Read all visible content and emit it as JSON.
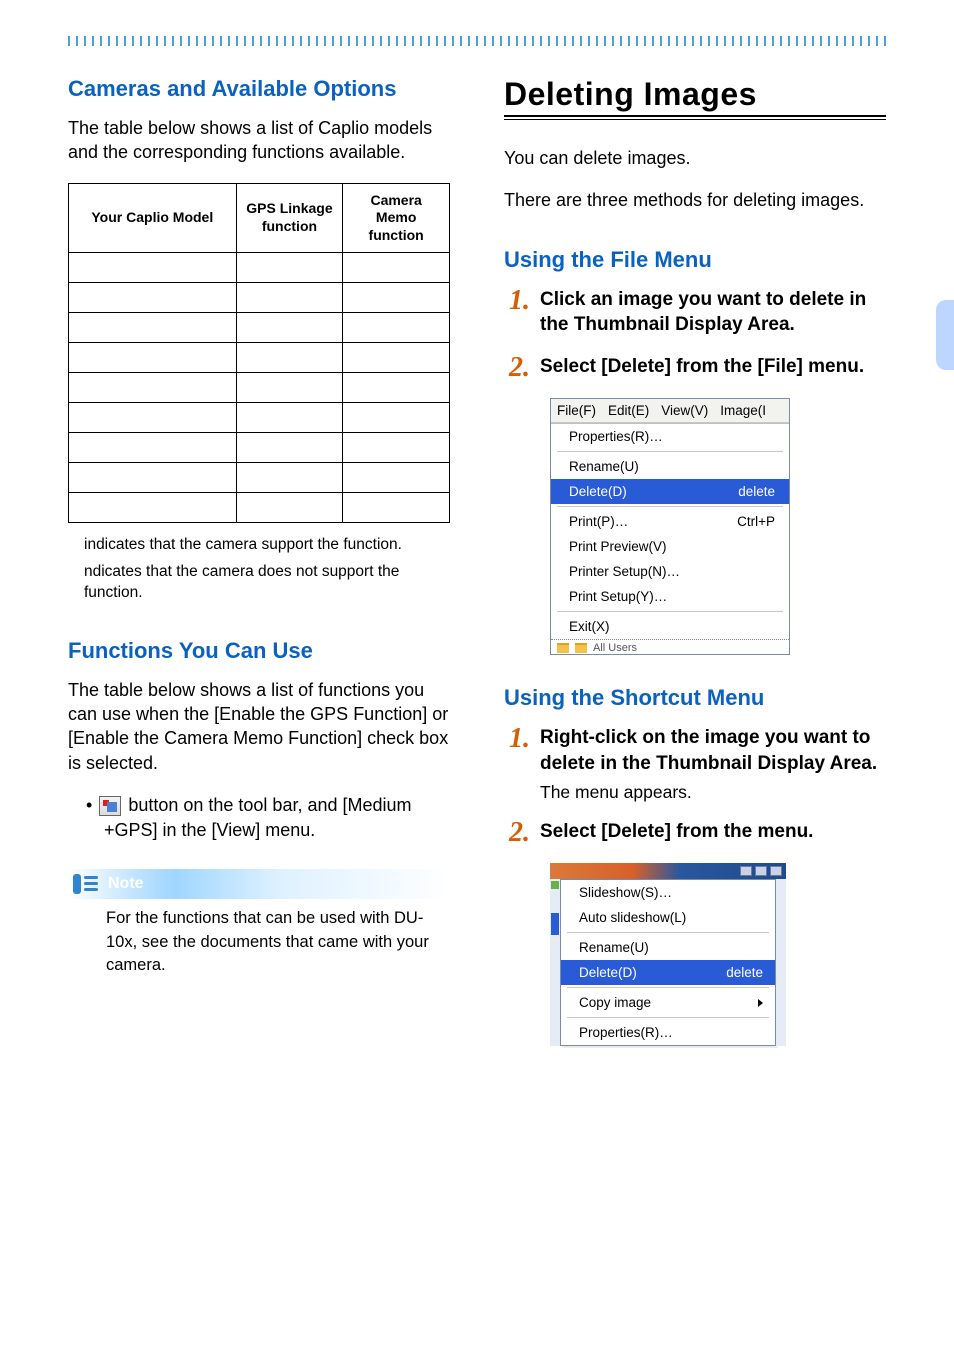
{
  "left": {
    "cameras": {
      "heading": "Cameras and Available Options",
      "intro": "The table below shows a list of Caplio models and the corresponding functions available.",
      "columns": {
        "model": "Your Caplio Model",
        "gps": "GPS Linkage function",
        "memo": "Camera Memo function"
      },
      "row_count": 9,
      "footnote1": "indicates that the camera support the function.",
      "footnote2": "ndicates that the camera does not support the function."
    },
    "functions": {
      "heading": "Functions You Can Use",
      "intro": "The table below shows a list of functions you can use when the [Enable the GPS Function] or [Enable the Camera Memo Function] check box is selected.",
      "bullet1_a": " button on the tool bar, and [Medium +GPS] in the [View] menu.",
      "icon_name": "medium-gps-toolbar-icon"
    },
    "note": {
      "label": "Note",
      "text": "For the functions that can be used with DU-10x, see the documents that came with your camera."
    }
  },
  "right": {
    "title": "Deleting Images",
    "intro1": "You can delete images.",
    "intro2": "There are three methods for deleting images.",
    "filemenu": {
      "heading": "Using the File Menu",
      "step1": "Click an image you want to delete in the Thumbnail Display Area.",
      "step2": "Select [Delete] from the [File] menu.",
      "shot": {
        "menubar": [
          "File(F)",
          "Edit(E)",
          "View(V)",
          "Image(I"
        ],
        "items": [
          {
            "label": "Properties(R)…",
            "accel": ""
          },
          {
            "sep": true
          },
          {
            "label": "Rename(U)",
            "accel": ""
          },
          {
            "label": "Delete(D)",
            "accel": "delete",
            "sel": true
          },
          {
            "sep": true
          },
          {
            "label": "Print(P)…",
            "accel": "Ctrl+P"
          },
          {
            "label": "Print Preview(V)",
            "accel": ""
          },
          {
            "label": "Printer Setup(N)…",
            "accel": ""
          },
          {
            "label": "Print Setup(Y)…",
            "accel": ""
          },
          {
            "sep": true
          },
          {
            "label": "Exit(X)",
            "accel": ""
          }
        ],
        "trail": "All Users"
      }
    },
    "shortcut": {
      "heading": "Using the Shortcut Menu",
      "step1": "Right-click on the image you want to delete in the Thumbnail Display Area.",
      "step1_body": "The menu appears.",
      "step2": "Select [Delete] from the menu.",
      "shot": {
        "items": [
          {
            "label": "Slideshow(S)…",
            "accel": ""
          },
          {
            "label": "Auto slideshow(L)",
            "accel": ""
          },
          {
            "sep": true
          },
          {
            "label": "Rename(U)",
            "accel": ""
          },
          {
            "label": "Delete(D)",
            "accel": "delete",
            "sel": true
          },
          {
            "sep": true
          },
          {
            "label": "Copy image",
            "accel": "",
            "sub": true
          },
          {
            "sep": true
          },
          {
            "label": "Properties(R)…",
            "accel": ""
          }
        ]
      }
    },
    "step_numbers": {
      "one": "1.",
      "two": "2."
    }
  }
}
